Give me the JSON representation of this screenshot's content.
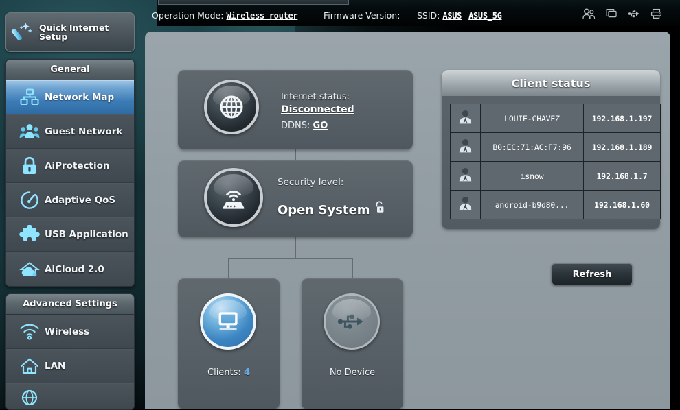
{
  "topbar": {
    "operation_mode_label": "Operation Mode:",
    "operation_mode_value": "Wireless router",
    "firmware_label": "Firmware Version:",
    "firmware_value": "",
    "ssid_label": "SSID:",
    "ssid_value_1": "ASUS",
    "ssid_value_2": "ASUS_5G",
    "icons": [
      "guest-users-icon",
      "clients-screen-icon",
      "usb-icon",
      "printer-icon"
    ]
  },
  "sidebar": {
    "quick_internet_setup": "Quick Internet Setup",
    "groups": [
      {
        "title": "General",
        "items": [
          {
            "label": "Network Map",
            "icon": "network-map-icon",
            "active": true
          },
          {
            "label": "Guest Network",
            "icon": "guest-network-icon",
            "active": false
          },
          {
            "label": "AiProtection",
            "icon": "shield-lock-icon",
            "active": false
          },
          {
            "label": "Adaptive QoS",
            "icon": "speedometer-icon",
            "active": false
          },
          {
            "label": "USB Application",
            "icon": "puzzle-piece-icon",
            "active": false
          },
          {
            "label": "AiCloud 2.0",
            "icon": "cloud-home-icon",
            "active": false
          }
        ]
      },
      {
        "title": "Advanced Settings",
        "items": [
          {
            "label": "Wireless",
            "icon": "wifi-icon",
            "active": false
          },
          {
            "label": "LAN",
            "icon": "house-icon",
            "active": false
          },
          {
            "label": "",
            "icon": "wan-globe-icon",
            "active": false
          }
        ]
      }
    ]
  },
  "network_map": {
    "internet": {
      "status_label": "Internet status:",
      "status_value": "Disconnected",
      "ddns_label": "DDNS:",
      "ddns_action": "GO",
      "icon": "globe-icon"
    },
    "security": {
      "label": "Security level:",
      "value": "Open System",
      "lock_icon": "unlocked-padlock-icon",
      "icon": "router-signal-icon"
    },
    "clients_node": {
      "caption_label": "Clients:",
      "count": "4",
      "icon": "monitor-icon"
    },
    "usb_node": {
      "caption_label": "No Device",
      "icon": "usb-icon"
    }
  },
  "client_status": {
    "title": "Client status",
    "rows": [
      {
        "icon": "user-icon",
        "name": "LOUIE-CHAVEZ",
        "ip": "192.168.1.197"
      },
      {
        "icon": "user-icon",
        "name": "B0:EC:71:AC:F7:96",
        "ip": "192.168.1.189"
      },
      {
        "icon": "user-icon",
        "name": "isnow",
        "ip": "192.168.1.7"
      },
      {
        "icon": "user-icon",
        "name": "android-b9d80...",
        "ip": "192.168.1.60"
      }
    ],
    "refresh_label": "Refresh"
  },
  "colors": {
    "accent_blue": "#3c7cb6",
    "panel_gray": "#939ea4",
    "node_gray": "#576066",
    "icon_cyan": "#7fd4f5",
    "count_blue": "#69a9e0"
  }
}
